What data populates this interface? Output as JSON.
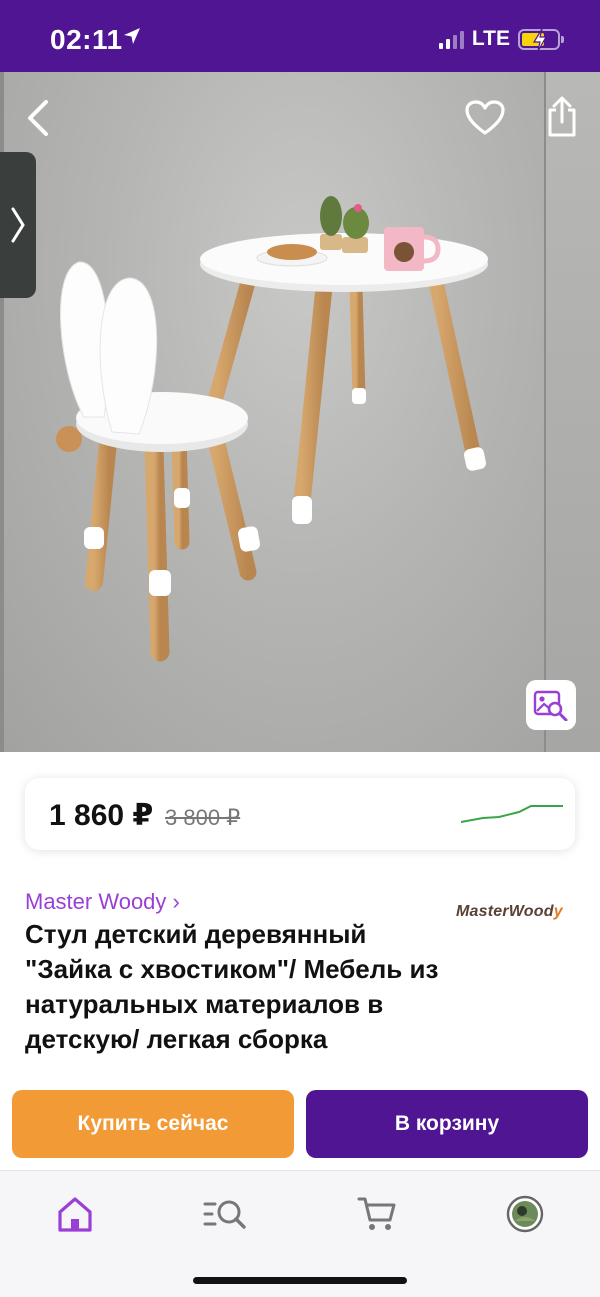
{
  "status_bar": {
    "time": "02:11",
    "network": "LTE",
    "bg": "#4f1593"
  },
  "gallery": {
    "icons": {
      "back": "chevron-left-icon",
      "favorite": "heart-icon",
      "share": "share-icon",
      "side": "chevron-right-icon",
      "image_search": "image-search-icon"
    }
  },
  "price_card": {
    "price": "1 860 ₽",
    "old_price": "3 800 ₽"
  },
  "product": {
    "brand": "Master Woody ›",
    "brand_logo_main": "MasterWood",
    "brand_logo_tail": "y",
    "title": "Стул детский деревянный \"Зайка с хвостиком\"/ Мебель из натуральных материалов в детскую/ легкая сборка"
  },
  "actions": {
    "buy_now": "Купить сейчас",
    "add_to_cart": "В корзину",
    "buy_color": "#f29a36",
    "cart_color": "#4f1593"
  },
  "tabbar": {
    "items": [
      "home-icon",
      "catalog-search-icon",
      "cart-icon",
      "profile-avatar"
    ],
    "active_color": "#9a3fd6"
  }
}
